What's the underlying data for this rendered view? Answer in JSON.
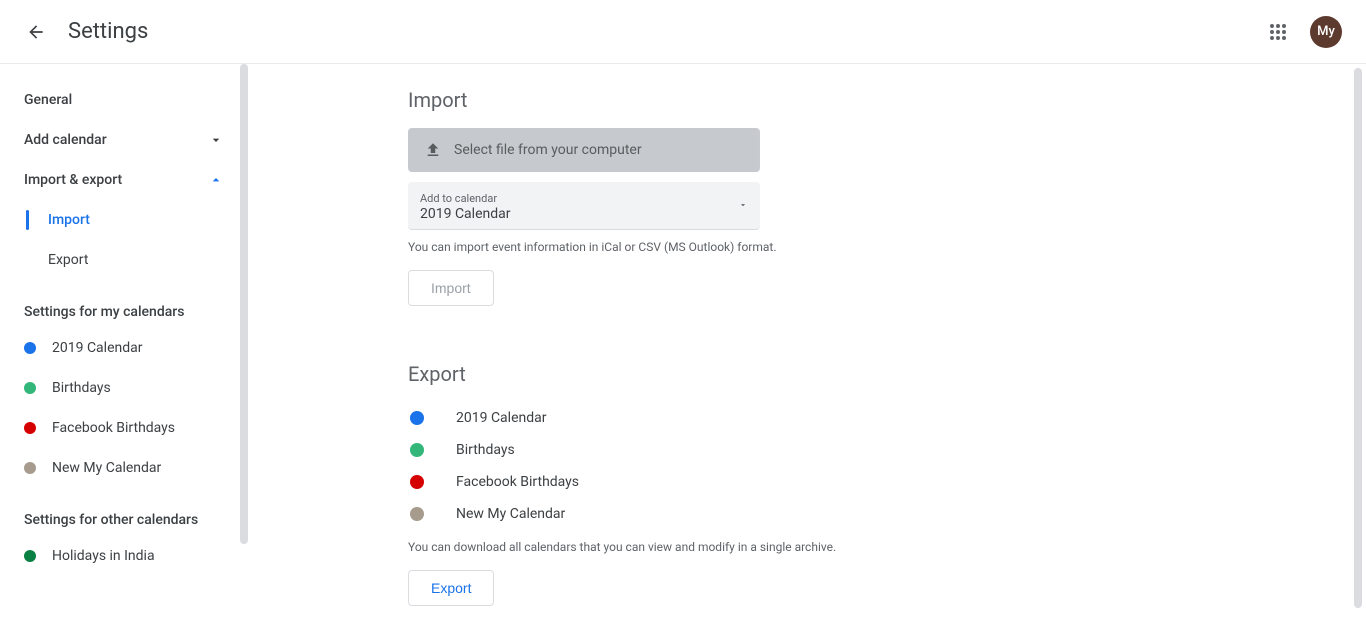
{
  "header": {
    "title": "Settings",
    "avatar_text": "My"
  },
  "sidebar": {
    "general": "General",
    "add_calendar": "Add calendar",
    "import_export": "Import & export",
    "sub_import": "Import",
    "sub_export": "Export",
    "my_calendars_header": "Settings for my calendars",
    "my_calendars": [
      {
        "name": "2019 Calendar",
        "color": "#1a73e8"
      },
      {
        "name": "Birthdays",
        "color": "#33b679"
      },
      {
        "name": "Facebook Birthdays",
        "color": "#d50000"
      },
      {
        "name": "New My Calendar",
        "color": "#a79b8e"
      }
    ],
    "other_calendars_header": "Settings for other calendars",
    "other_calendars": [
      {
        "name": "Holidays in India",
        "color": "#0b8043"
      }
    ]
  },
  "import": {
    "title": "Import",
    "file_button": "Select file from your computer",
    "dropdown_label": "Add to calendar",
    "dropdown_value": "2019 Calendar",
    "help": "You can import event information in iCal or CSV (MS Outlook) format.",
    "button": "Import"
  },
  "export": {
    "title": "Export",
    "calendars": [
      {
        "name": "2019 Calendar",
        "color": "#1a73e8"
      },
      {
        "name": "Birthdays",
        "color": "#33b679"
      },
      {
        "name": "Facebook Birthdays",
        "color": "#d50000"
      },
      {
        "name": "New My Calendar",
        "color": "#a79b8e"
      }
    ],
    "help": "You can download all calendars that you can view and modify in a single archive.",
    "button": "Export"
  }
}
